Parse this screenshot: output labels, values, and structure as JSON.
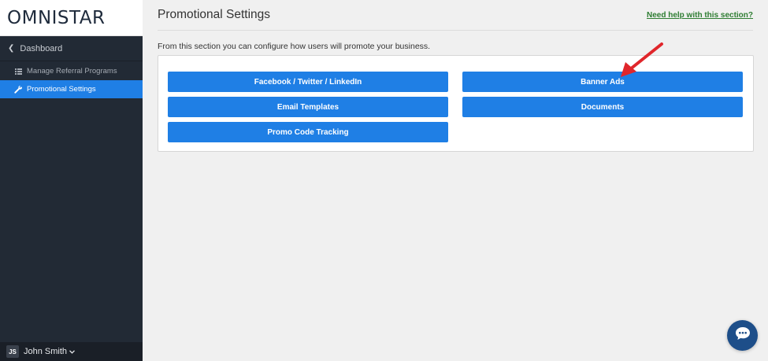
{
  "brand": {
    "logo_text_1": "OMNIS",
    "logo_star_a": "T",
    "logo_text_2": "AR",
    "logo_full": "OMNISTAR"
  },
  "sidebar": {
    "dashboard_label": "Dashboard",
    "items": [
      {
        "label": "Manage Referral Programs",
        "icon": "list-icon",
        "active": false
      },
      {
        "label": "Promotional Settings",
        "icon": "wrench-icon",
        "active": true
      }
    ],
    "user": {
      "initials": "JS",
      "name": "John Smith",
      "caret": "⌄"
    }
  },
  "main": {
    "title": "Promotional Settings",
    "help_link": "Need help with this section?",
    "description": "From this section you can configure how users will promote your business.",
    "buttons": {
      "facebook": "Facebook / Twitter / LinkedIn",
      "banner_ads": "Banner Ads",
      "email_templates": "Email Templates",
      "documents": "Documents",
      "promo_code": "Promo Code Tracking"
    }
  },
  "colors": {
    "sidebar_bg": "#222a35",
    "accent_blue": "#1f7fe5",
    "help_green": "#2e7d32",
    "arrow_red": "#e0262b",
    "chat_bg": "#1d4e89"
  }
}
